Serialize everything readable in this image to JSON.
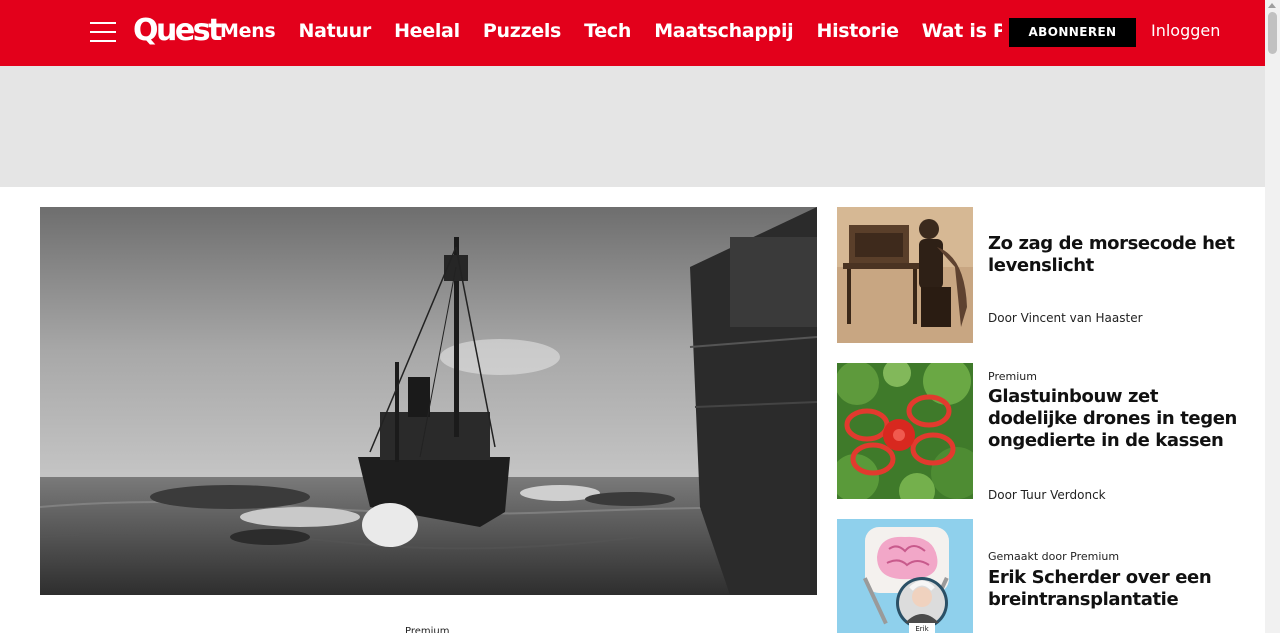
{
  "header": {
    "logo_text": "Quest",
    "nav_items": [
      "Mens",
      "Natuur",
      "Heelal",
      "Puzzels",
      "Tech",
      "Maatschappij",
      "Historie",
      "Wat is Premiu"
    ],
    "subscribe_label": "ABONNEREN",
    "login_label": "Inloggen",
    "brand_color": "#e3001b"
  },
  "hero": {
    "kicker": "Premium"
  },
  "sidebar_articles": [
    {
      "kicker": "",
      "title": "Zo zag de morsecode het levenslicht",
      "author": "Door Vincent van Haaster"
    },
    {
      "kicker": "Premium",
      "title": "Glastuinbouw zet dodelijke drones in tegen ongedierte in de kassen",
      "author": "Door Tuur Verdonck"
    },
    {
      "kicker": "Gemaakt door Premium",
      "title": "Erik Scherder over een breintransplantatie",
      "author": "",
      "image_caption": "Erik"
    }
  ]
}
